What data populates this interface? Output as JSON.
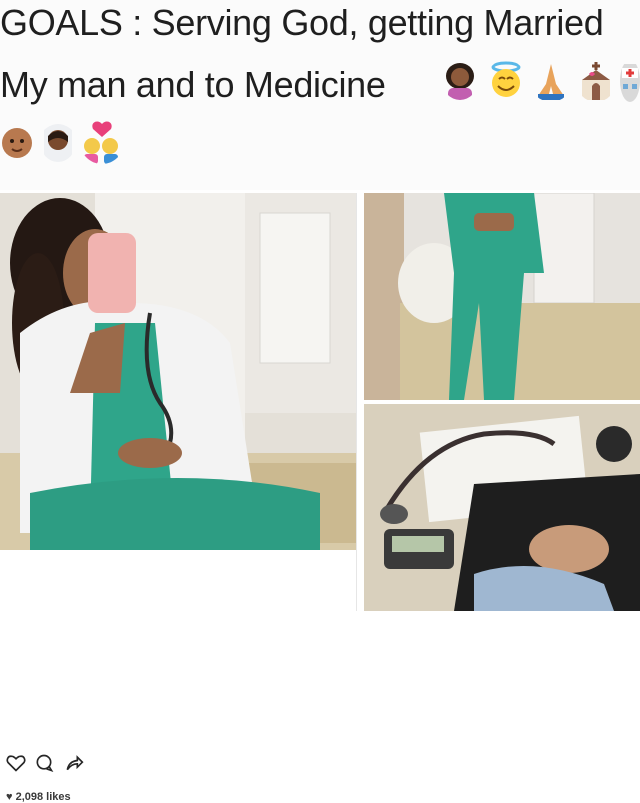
{
  "caption": {
    "line1": "GOALS : Serving God, getting Married",
    "line2": "My man and to  Medicine"
  },
  "emoji": {
    "row1": [
      "woman-icon",
      "smiling-angel-icon",
      "praying-hands-icon",
      "church-icon",
      "hospital-icon"
    ],
    "row2": [
      "baby-icon",
      "bride-icon",
      "kissing-couple-icon"
    ]
  },
  "post": {
    "likes_text": "2,098 likes",
    "actions": [
      "heart-icon",
      "comment-icon",
      "share-icon"
    ]
  },
  "colors": {
    "scrubs": "#2fa58a",
    "coat": "#f3f3f3",
    "phone": "#f1b3b0",
    "rug": "#d8caa8"
  }
}
